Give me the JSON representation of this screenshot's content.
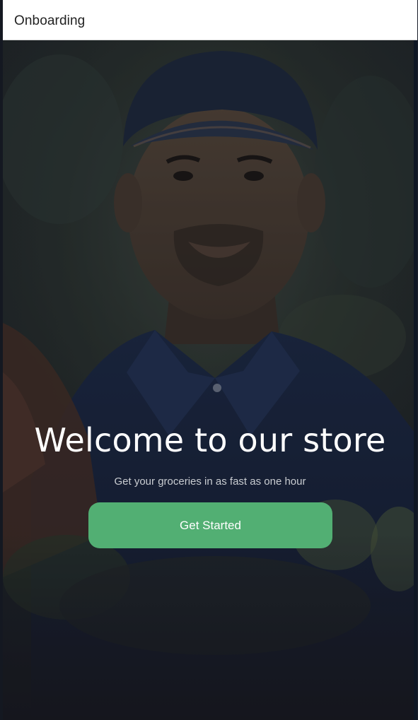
{
  "window": {
    "title": "Onboarding"
  },
  "hero": {
    "image_subject": "smiling delivery man in navy cap and polo shirt holding groceries",
    "headline": "Welcome to our store",
    "subtitle": "Get your groceries in as fast as one hour",
    "cta_label": "Get Started"
  },
  "colors": {
    "accent": "#52af73",
    "titlebar": "#ffffff",
    "overlay": "#0a0e18"
  }
}
